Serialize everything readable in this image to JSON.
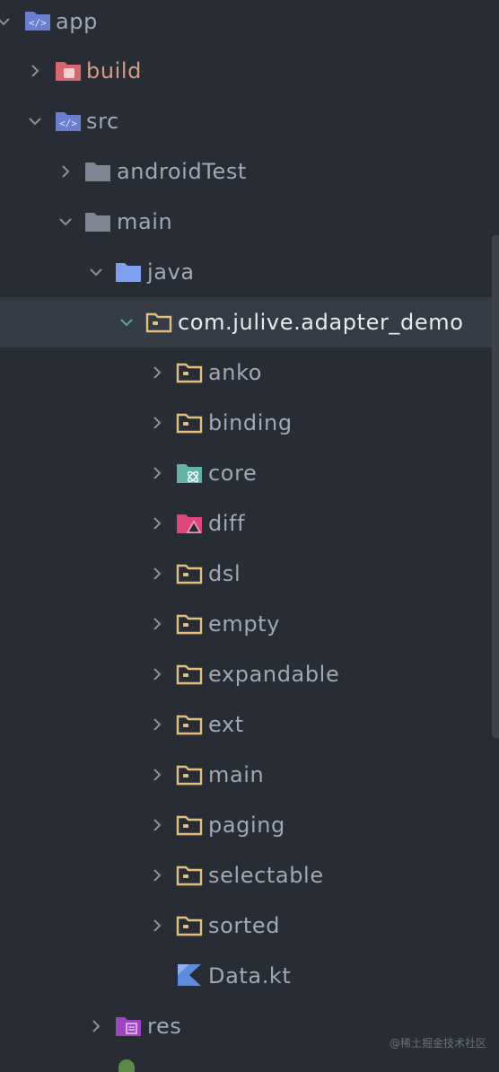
{
  "tree": {
    "items": [
      {
        "label": "app",
        "icon": "module-folder-icon"
      },
      {
        "label": "build",
        "icon": "excluded-folder-icon"
      },
      {
        "label": "src",
        "icon": "module-folder-icon"
      },
      {
        "label": "androidTest",
        "icon": "folder-icon"
      },
      {
        "label": "main",
        "icon": "folder-icon"
      },
      {
        "label": "java",
        "icon": "source-folder-icon"
      },
      {
        "label": "com.julive.adapter_demo",
        "icon": "package-icon"
      },
      {
        "label": "anko",
        "icon": "package-icon"
      },
      {
        "label": "binding",
        "icon": "package-icon"
      },
      {
        "label": "core",
        "icon": "core-package-icon"
      },
      {
        "label": "diff",
        "icon": "diff-package-icon"
      },
      {
        "label": "dsl",
        "icon": "package-icon"
      },
      {
        "label": "empty",
        "icon": "package-icon"
      },
      {
        "label": "expandable",
        "icon": "package-icon"
      },
      {
        "label": "ext",
        "icon": "package-icon"
      },
      {
        "label": "main",
        "icon": "package-icon"
      },
      {
        "label": "paging",
        "icon": "package-icon"
      },
      {
        "label": "selectable",
        "icon": "package-icon"
      },
      {
        "label": "sorted",
        "icon": "package-icon"
      },
      {
        "label": "Data.kt",
        "icon": "kotlin-file-icon"
      },
      {
        "label": "res",
        "icon": "resources-folder-icon"
      }
    ]
  },
  "watermark": "@稀土掘金技术社区",
  "colors": {
    "background": "#282c34",
    "selected_row": "#353b45",
    "text": "#a0a8b4",
    "package_folder": "#e5c07b",
    "module_folder": "#6a7fd0",
    "build_folder": "#e06c75",
    "core_folder": "#56b6c2",
    "diff_folder": "#e0457b",
    "res_folder": "#a045c0",
    "kotlin": "#5b8cdf"
  }
}
